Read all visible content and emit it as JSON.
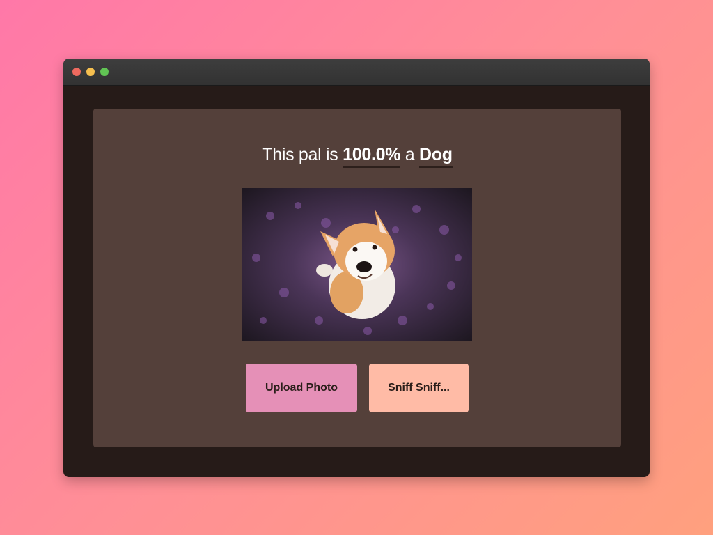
{
  "window": {
    "traffic_lights": [
      "close",
      "minimize",
      "maximize"
    ]
  },
  "result": {
    "prefix": "This pal is ",
    "percent": "100.0%",
    "middle": " a ",
    "label": "Dog"
  },
  "photo": {
    "subject": "dog-photo"
  },
  "buttons": {
    "upload_label": "Upload Photo",
    "sniff_label": "Sniff Sniff..."
  },
  "colors": {
    "upload_button": "#e590b7",
    "sniff_button": "#ffbba6",
    "panel": "#54403a",
    "window": "#261b18"
  }
}
